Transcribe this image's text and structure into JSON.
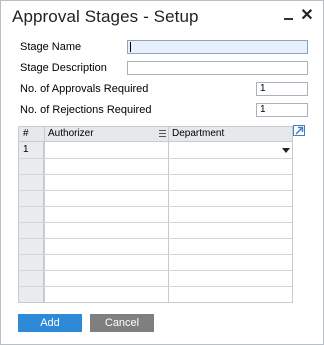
{
  "window": {
    "title": "Approval Stages - Setup"
  },
  "form": {
    "stage_name_label": "Stage Name",
    "stage_name_value": "",
    "stage_description_label": "Stage Description",
    "stage_description_value": "",
    "approvals_label": "No. of Approvals Required",
    "approvals_value": "1",
    "rejections_label": "No. of Rejections Required",
    "rejections_value": "1"
  },
  "grid": {
    "columns": [
      "#",
      "Authorizer",
      "Department"
    ],
    "rows": [
      {
        "num": "1",
        "authorizer": "",
        "department": ""
      }
    ]
  },
  "buttons": {
    "add_label": "Add",
    "cancel_label": "Cancel"
  },
  "colors": {
    "add": "#2e8ad8",
    "cancel": "#7f7f7f",
    "active_field": "#e8f1fb"
  },
  "icons": [
    "minimize-icon",
    "close-icon",
    "column-menu-icon",
    "dropdown-arrow-icon",
    "expand-link-icon"
  ]
}
